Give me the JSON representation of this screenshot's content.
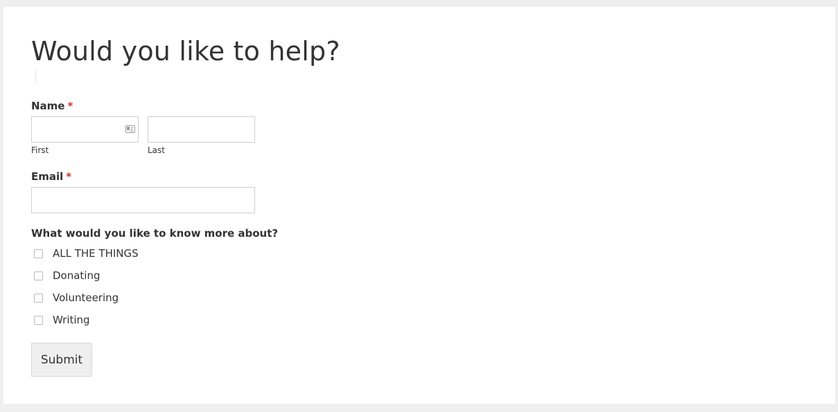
{
  "form": {
    "title": "Would you like to help?",
    "name": {
      "label": "Name",
      "required_marker": "*",
      "first": {
        "sublabel": "First",
        "value": "",
        "placeholder": ""
      },
      "last": {
        "sublabel": "Last",
        "value": "",
        "placeholder": ""
      }
    },
    "email": {
      "label": "Email",
      "required_marker": "*",
      "value": "",
      "placeholder": ""
    },
    "interests": {
      "label": "What would you like to know more about?",
      "options": [
        {
          "label": "ALL THE THINGS",
          "checked": false
        },
        {
          "label": "Donating",
          "checked": false
        },
        {
          "label": "Volunteering",
          "checked": false
        },
        {
          "label": "Writing",
          "checked": false
        }
      ]
    },
    "submit_label": "Submit"
  },
  "icons": {
    "first_name_autofill": "contact-card-icon"
  },
  "colors": {
    "page_background": "#efefef",
    "card_background": "#ffffff",
    "text": "#333333",
    "required": "#c0392b",
    "input_border": "#cfcfcf",
    "button_background": "#efefef"
  }
}
